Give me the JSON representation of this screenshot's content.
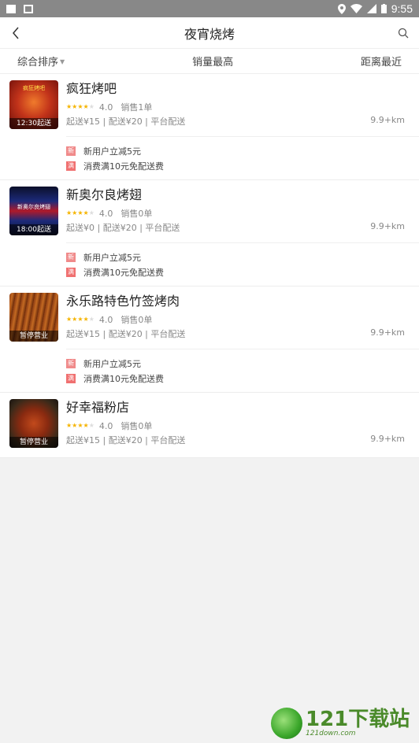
{
  "statusbar": {
    "time": "9:55"
  },
  "navbar": {
    "title": "夜宵烧烤"
  },
  "sortbar": {
    "items": [
      {
        "label": "综合排序",
        "has_caret": true
      },
      {
        "label": "销量最高"
      },
      {
        "label": "距离最近"
      }
    ]
  },
  "shops": [
    {
      "name": "疯狂烤吧",
      "thumb_caption": "12:30起送",
      "thumb_banner": "疯狂烤吧",
      "rating": "4.0",
      "sales": "销售1单",
      "delivery_info": "起送¥15 | 配送¥20 | 平台配送",
      "distance": "9.9+km",
      "promos": [
        {
          "tag": "新",
          "text": "新用户立减5元"
        },
        {
          "tag": "满",
          "text": "消费满10元免配送费"
        }
      ]
    },
    {
      "name": "新奥尔良烤翅",
      "thumb_caption": "18:00起送",
      "thumb_banner": "新奥尔良烤翅",
      "rating": "4.0",
      "sales": "销售0单",
      "delivery_info": "起送¥0 | 配送¥20 | 平台配送",
      "distance": "9.9+km",
      "promos": [
        {
          "tag": "新",
          "text": "新用户立减5元"
        },
        {
          "tag": "满",
          "text": "消费满10元免配送费"
        }
      ]
    },
    {
      "name": "永乐路特色竹签烤肉",
      "thumb_caption": "暂停营业",
      "rating": "4.0",
      "sales": "销售0单",
      "delivery_info": "起送¥15 | 配送¥20 | 平台配送",
      "distance": "9.9+km",
      "promos": [
        {
          "tag": "新",
          "text": "新用户立减5元"
        },
        {
          "tag": "满",
          "text": "消费满10元免配送费"
        }
      ]
    },
    {
      "name": "好幸福粉店",
      "thumb_caption": "暂停营业",
      "rating": "4.0",
      "sales": "销售0单",
      "delivery_info": "起送¥15 | 配送¥20 | 平台配送",
      "distance": "9.9+km",
      "promos": []
    }
  ],
  "watermark": {
    "main": "121下载站",
    "sub": "121down.com"
  }
}
